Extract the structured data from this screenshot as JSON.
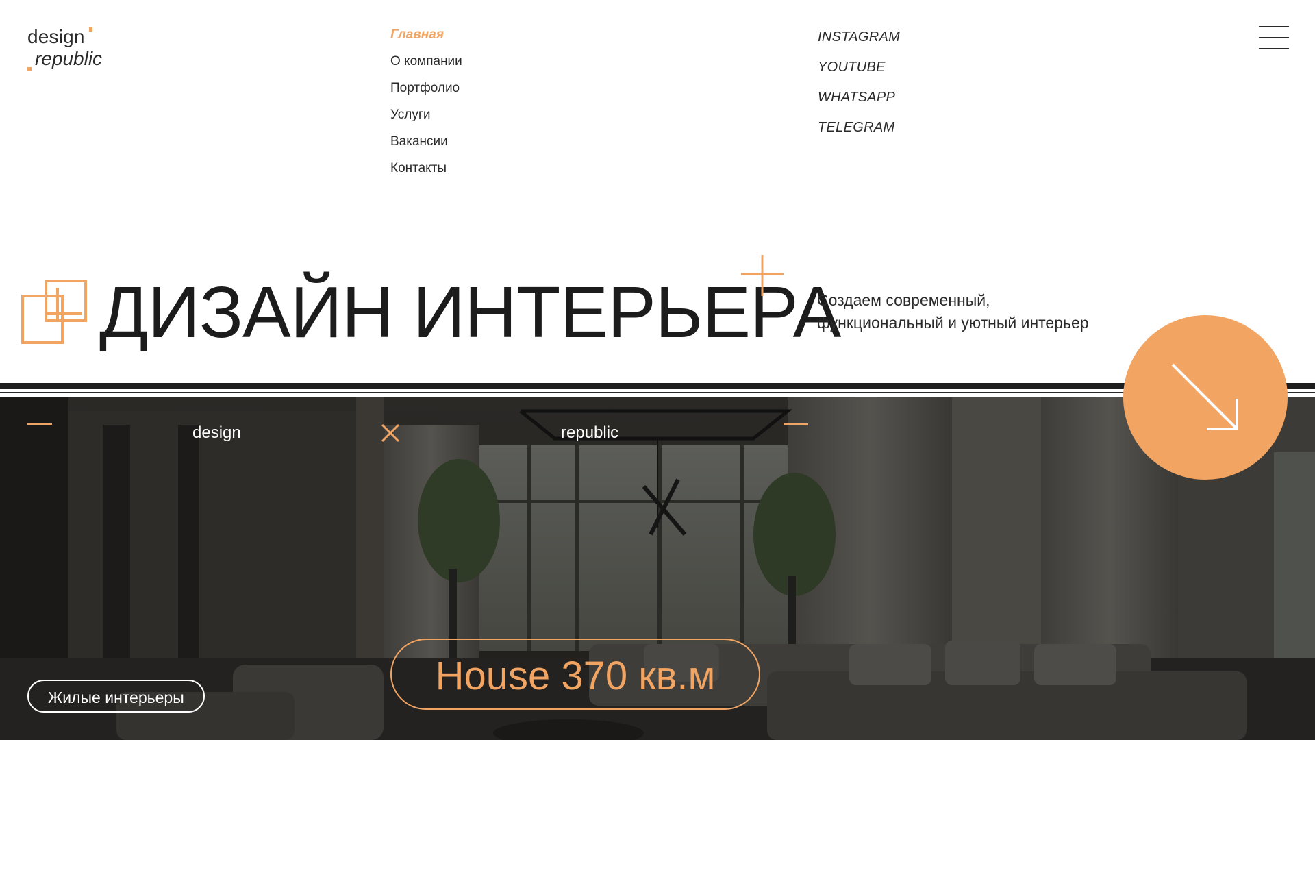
{
  "logo": {
    "line1": "design",
    "line2": "republic"
  },
  "nav": {
    "items": [
      {
        "label": "Главная",
        "active": true
      },
      {
        "label": "О компании"
      },
      {
        "label": "Портфолио"
      },
      {
        "label": "Услуги"
      },
      {
        "label": "Вакансии"
      },
      {
        "label": "Контакты"
      }
    ]
  },
  "social": {
    "items": [
      {
        "label": "INSTAGRAM"
      },
      {
        "label": "YOUTUBE"
      },
      {
        "label": "WHATSAPP"
      },
      {
        "label": "TELEGRAM"
      }
    ]
  },
  "menu_icon": "hamburger-icon",
  "hero": {
    "title": "ДИЗАЙН ИНТЕРЬЕРА",
    "tagline_line1": "Создаем современный,",
    "tagline_line2": "функциональный и уютный интерьер",
    "icon": "overlapping-squares-plus-icon",
    "deco_icon": "plus-icon"
  },
  "photo": {
    "word_left": "design",
    "word_right": "republic",
    "category_label": "Жилые интерьеры",
    "project_label": "House 370 кв.м"
  },
  "scroll_button": {
    "icon": "arrow-down-right-icon"
  },
  "colors": {
    "accent": "#f2a463",
    "text": "#1f1f1f",
    "rule": "#1e1e1e"
  }
}
